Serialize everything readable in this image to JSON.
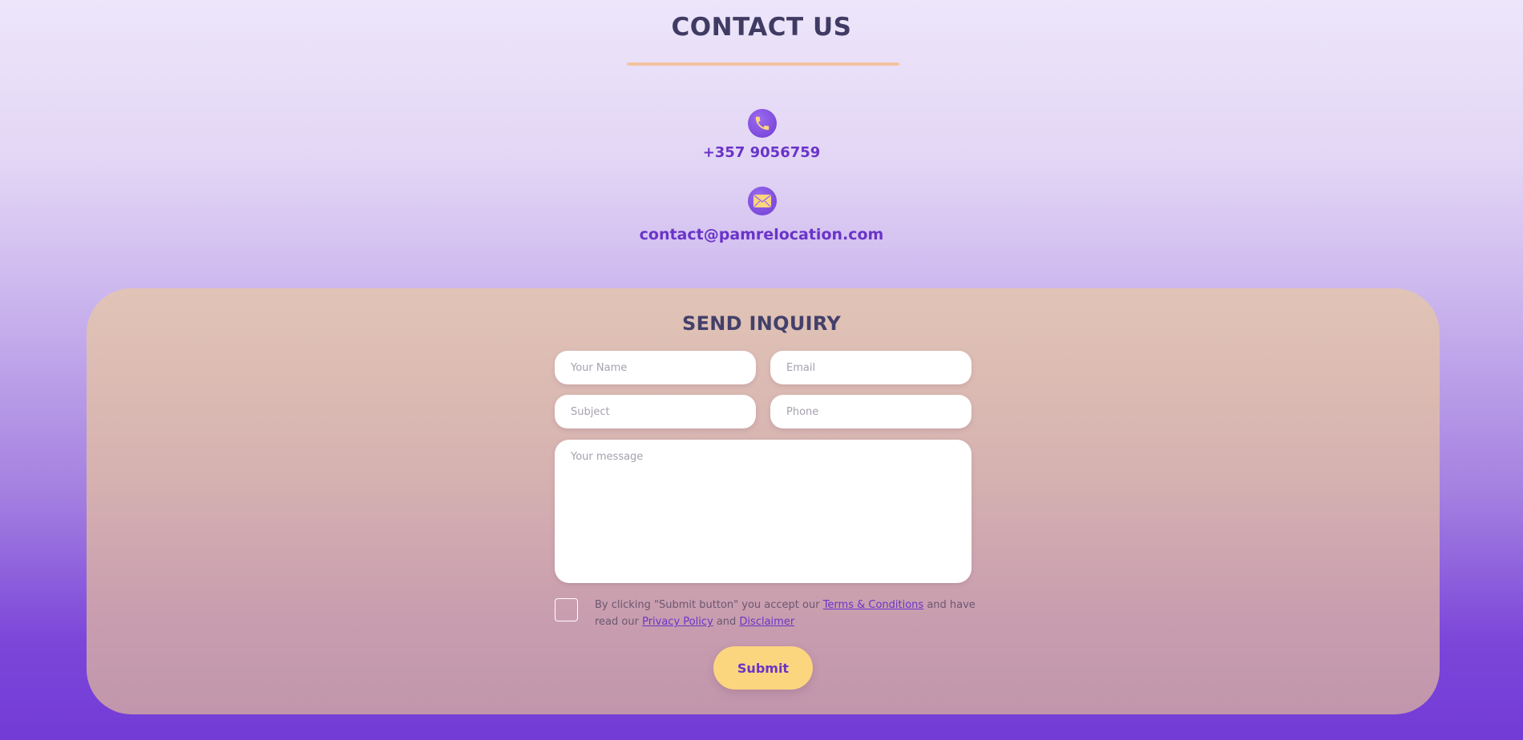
{
  "header": {
    "title": "CONTACT US"
  },
  "contact": {
    "phone_icon": "phone-icon",
    "phone": "+357 9056759",
    "email_icon": "envelope-icon",
    "email": "contact@pamrelocation.com"
  },
  "inquiry": {
    "title": "SEND INQUIRY",
    "name_placeholder": "Your Name",
    "email_placeholder": "Email",
    "subject_placeholder": "Subject",
    "phone_placeholder": "Phone",
    "message_placeholder": "Your message",
    "consent": {
      "text_before": "By clicking \"Submit button\" you accept our ",
      "terms_link": "Terms & Conditions",
      "text_middle": " and have read our ",
      "privacy_link": "Privacy Policy",
      "text_and": " and ",
      "disclaimer_link": "Disclaimer"
    },
    "submit_label": "Submit"
  },
  "colors": {
    "accent": "#6a34c8",
    "title": "#403b63",
    "button": "#fcd57f",
    "rule": "#f3c3a0"
  }
}
